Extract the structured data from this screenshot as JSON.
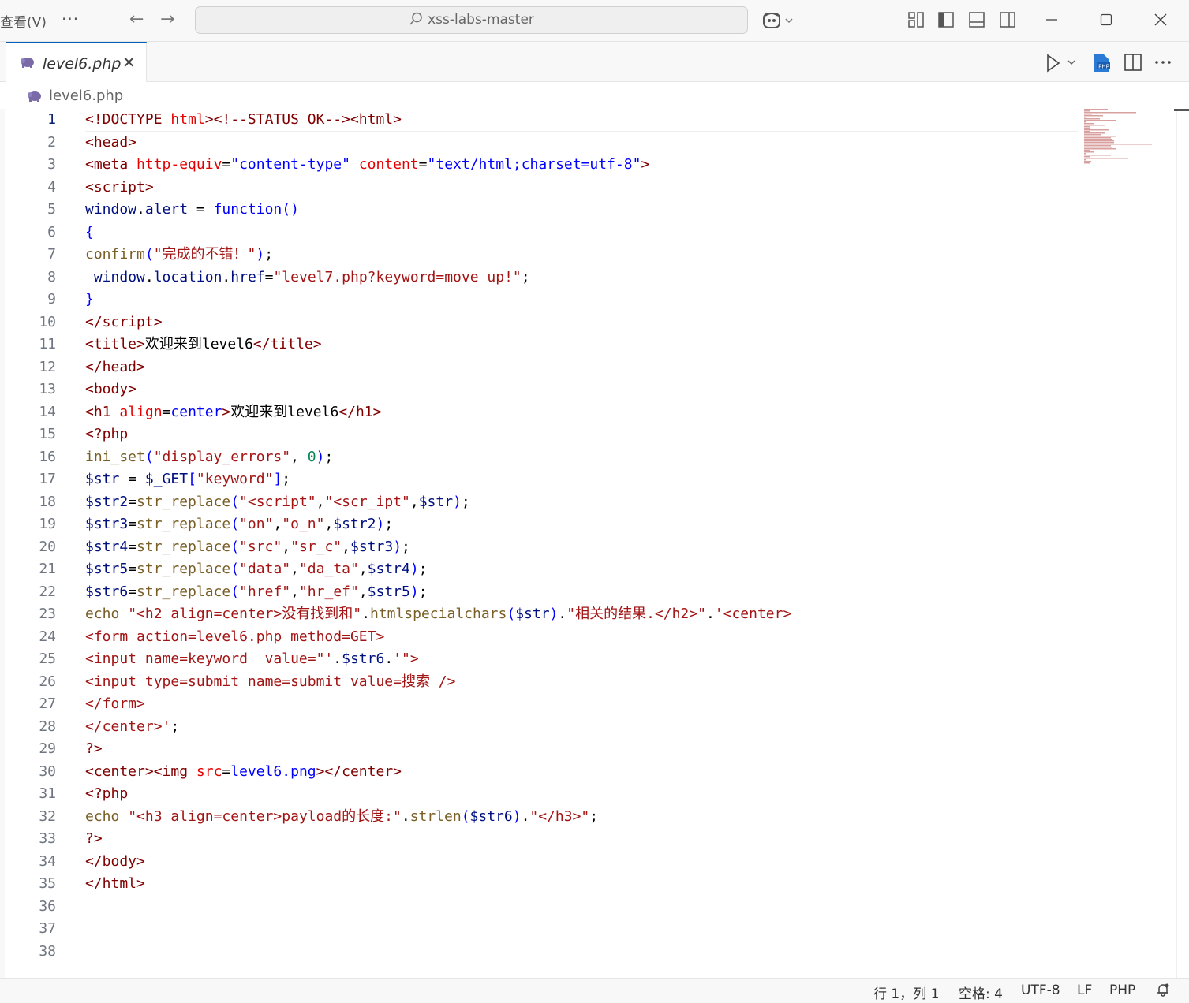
{
  "titlebar": {
    "menu_view": "查看(V)",
    "more": "···",
    "back": "←",
    "forward": "→",
    "search_text": "xss-labs-master"
  },
  "tab": {
    "label": "level6.php",
    "close": "✕"
  },
  "breadcrumb": {
    "file": "level6.php"
  },
  "icons": {
    "search": "search-icon",
    "copilot": "copilot-icon",
    "php": "php-elephant-icon",
    "run": "run-icon",
    "split": "split-editor-icon"
  },
  "colors": {
    "accent": "#005fb8",
    "tag": "#800000",
    "attribute": "#e50000",
    "string": "#0000ff",
    "function": "#795e26",
    "variable": "#001080",
    "number": "#098658"
  },
  "editor": {
    "line_numbers": [
      "1",
      "2",
      "3",
      "4",
      "5",
      "6",
      "7",
      "8",
      "9",
      "10",
      "11",
      "12",
      "13",
      "14",
      "15",
      "16",
      "17",
      "18",
      "19",
      "20",
      "21",
      "22",
      "23",
      "24",
      "25",
      "26",
      "27",
      "28",
      "29",
      "30",
      "31",
      "32",
      "33",
      "34",
      "35",
      "36",
      "37",
      "38"
    ],
    "active_line": 1
  },
  "statusbar": {
    "position": "行 1，列 1",
    "spaces": "空格: 4",
    "encoding": "UTF-8",
    "eol": "LF",
    "language": "PHP"
  }
}
